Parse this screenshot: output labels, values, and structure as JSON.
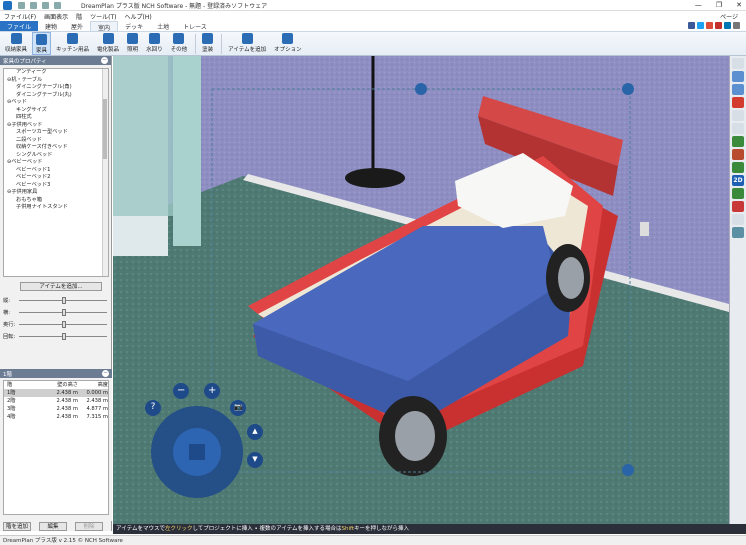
{
  "window": {
    "title": "DreamPlan プラス版 NCH Software - 無題 - 登録済みソフトウェア",
    "controls": [
      "—",
      "❐",
      "✕"
    ]
  },
  "menu": {
    "items": [
      "ファイル(F)",
      "画面表示",
      "階",
      "ツール(T)",
      "ヘルプ(H)"
    ],
    "right": "ページ"
  },
  "tabs": {
    "file": "ファイル",
    "items": [
      "建物",
      "屋外",
      "室内",
      "デッキ",
      "土地",
      "トレース"
    ],
    "active": "室内"
  },
  "toolbar": {
    "buttons": [
      {
        "label": "収納家具",
        "icon": "cabinet-icon",
        "color": "#2b6cb5"
      },
      {
        "label": "家具",
        "icon": "chair-icon",
        "color": "#2b6cb5"
      },
      {
        "label": "キッチン用品",
        "icon": "kitchen-icon",
        "color": "#2b6cb5"
      },
      {
        "label": "電化製品",
        "icon": "tv-icon",
        "color": "#2b6cb5"
      },
      {
        "label": "照明",
        "icon": "lamp-icon",
        "color": "#2b6cb5"
      },
      {
        "label": "水回り",
        "icon": "faucet-icon",
        "color": "#2b6cb5"
      },
      {
        "label": "その他",
        "icon": "misc-icon",
        "color": "#2b6cb5"
      },
      {
        "label": "塗装",
        "icon": "paint-icon",
        "color": "#2b6cb5"
      },
      {
        "label": "アイテムを追加",
        "icon": "add-item-icon",
        "color": "#2b6cb5"
      },
      {
        "label": "オプション",
        "icon": "options-icon",
        "color": "#2b6cb5"
      }
    ],
    "active": "家具"
  },
  "furniture_panel": {
    "title": "家具のプロパティ",
    "tree": [
      {
        "label": "アンティーク",
        "level": 2
      },
      {
        "label": "机・テーブル",
        "level": 1,
        "toggle": "⊖"
      },
      {
        "label": "ダイニングテーブル(角)",
        "level": 2
      },
      {
        "label": "ダイニングテーブル(丸)",
        "level": 2
      },
      {
        "label": "ベッド",
        "level": 1,
        "toggle": "⊖"
      },
      {
        "label": "キングサイズ",
        "level": 2
      },
      {
        "label": "四柱式",
        "level": 2
      },
      {
        "label": "子供用ベッド",
        "level": 1,
        "toggle": "⊖"
      },
      {
        "label": "スポーツカー型ベッド",
        "level": 2
      },
      {
        "label": "二段ベッド",
        "level": 2
      },
      {
        "label": "収納ケース付きベッド",
        "level": 2
      },
      {
        "label": "シングルベッド",
        "level": 2
      },
      {
        "label": "ベビーベッド",
        "level": 1,
        "toggle": "⊖"
      },
      {
        "label": "ベビーベッド1",
        "level": 2
      },
      {
        "label": "ベビーベッド2",
        "level": 2
      },
      {
        "label": "ベビーベッド3",
        "level": 2
      },
      {
        "label": "子供用家具",
        "level": 1,
        "toggle": "⊖"
      },
      {
        "label": "おもちゃ箱",
        "level": 2
      },
      {
        "label": "子供用ナイトスタンド",
        "level": 2
      }
    ],
    "add_button": "アイテムを追加...",
    "sliders": [
      {
        "label": "縦:",
        "value": 0.5
      },
      {
        "label": "横:",
        "value": 0.5
      },
      {
        "label": "奥行:",
        "value": 0.5
      },
      {
        "label": "回転:",
        "value": 0.5
      }
    ]
  },
  "levels_panel": {
    "title": "1階",
    "headers": [
      "階",
      "壁の高さ",
      "高度"
    ],
    "rows": [
      [
        "1階",
        "2.438 m",
        "0.000 m"
      ],
      [
        "2階",
        "2.438 m",
        "2.438 m"
      ],
      [
        "3階",
        "2.438 m",
        "4.877 m"
      ],
      [
        "4階",
        "2.438 m",
        "7.315 m"
      ]
    ],
    "buttons": [
      "階を追加",
      "編集",
      "削除"
    ]
  },
  "right_tools": [
    {
      "icon": "hand-icon",
      "color": "#d8dee6"
    },
    {
      "icon": "rotate-view-icon",
      "color": "#5b8fd0"
    },
    {
      "icon": "orbit-icon",
      "color": "#5b8fd0"
    },
    {
      "icon": "delete-icon",
      "color": "#d43b2f"
    },
    {
      "icon": "page-icon",
      "color": "#d8dee6"
    },
    {
      "icon": "texture-icon",
      "color": "#d8dee6"
    },
    {
      "icon": "eyedropper-icon",
      "color": "#3b8a3b"
    },
    {
      "icon": "palette-icon",
      "color": "#b84a2d"
    },
    {
      "icon": "view-3d-icon",
      "color": "#3b8a3b"
    },
    {
      "icon": "view-2d-icon",
      "label": "2D",
      "color": "#1c5fb3"
    },
    {
      "icon": "map-icon",
      "color": "#3b8a3b"
    },
    {
      "icon": "camera-icon",
      "color": "#c83838"
    },
    {
      "icon": "layers-icon",
      "color": "#d8dee6"
    },
    {
      "icon": "grid-icon",
      "color": "#5b8fa3"
    }
  ],
  "nav_controls": {
    "zoom_out": "−",
    "zoom_in": "+",
    "help": "?",
    "camera": "📷",
    "up": "▲",
    "down": "▼"
  },
  "status": {
    "hint_prefix": "アイテムをマウスで",
    "hint_highlight": "左クリック",
    "hint_middle": "してプロジェクトに挿入 • 複数のアイテムを挿入する場合は",
    "hint_key": "Shift",
    "hint_suffix": "キーを押しながら挿入",
    "version": "DreamPlan プラス版 v 2.15 © NCH Software"
  }
}
